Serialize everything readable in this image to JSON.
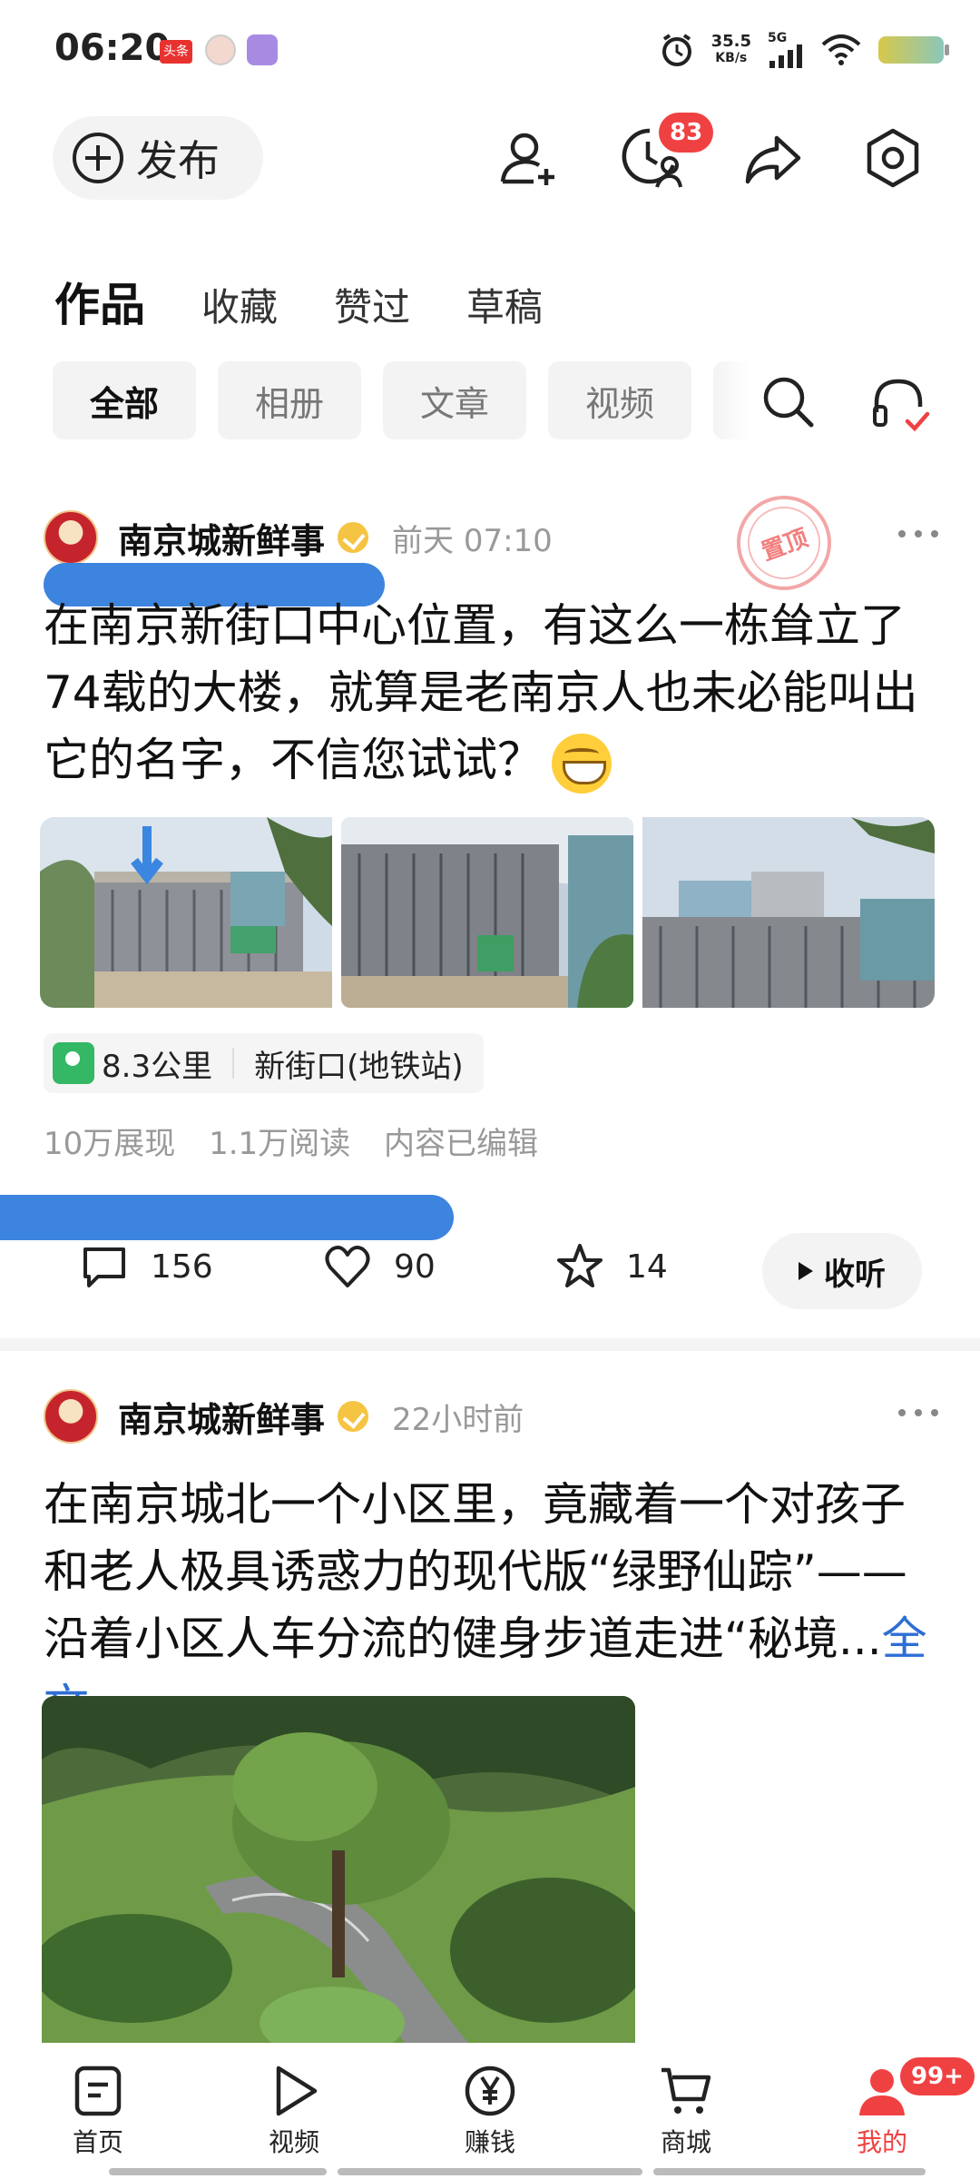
{
  "status_bar": {
    "time": "06:20",
    "app_badge": "头条",
    "net_speed": "35.5",
    "net_speed_unit": "KB/s",
    "network": "5G"
  },
  "topbar": {
    "publish_label": "发布",
    "notification_count": "83"
  },
  "tabs": [
    {
      "label": "作品",
      "active": true
    },
    {
      "label": "收藏"
    },
    {
      "label": "赞过"
    },
    {
      "label": "草稿"
    }
  ],
  "chips": [
    {
      "label": "全部",
      "active": true
    },
    {
      "label": "相册"
    },
    {
      "label": "文章"
    },
    {
      "label": "视频"
    }
  ],
  "posts": [
    {
      "author": "南京城新鲜事",
      "time": "前天  07:10",
      "pinned_stamp": "置顶",
      "text": "在南京新街口中心位置，有这么一栋耸立了74载的大楼，就算是老南京人也未必能叫出它的名字，不信您试试？",
      "location_distance": "8.3公里",
      "location_place": "新街口(地铁站)",
      "stats": [
        "10万展现",
        "1.1万阅读",
        "内容已编辑"
      ],
      "comments": "156",
      "likes": "90",
      "favorites": "14",
      "listen_label": "收听"
    },
    {
      "author": "南京城新鲜事",
      "time": "22小时前",
      "text": "在南京城北一个小区里，竟藏着一个对孩子和老人极具诱惑力的现代版“绿野仙踪”——沿着小区人车分流的健身步道走进“秘境...",
      "full_link": "全文"
    }
  ],
  "bottom_nav": [
    {
      "label": "首页",
      "icon": "home-doc-icon"
    },
    {
      "label": "视频",
      "icon": "play-icon"
    },
    {
      "label": "赚钱",
      "icon": "yen-coin-icon"
    },
    {
      "label": "商城",
      "icon": "cart-icon"
    },
    {
      "label": "我的",
      "icon": "person-icon",
      "active": true,
      "badge": "99+"
    }
  ],
  "colors": {
    "accent_red": "#f04142",
    "link_blue": "#2d6ed4",
    "scribble_blue": "#3d84de"
  }
}
